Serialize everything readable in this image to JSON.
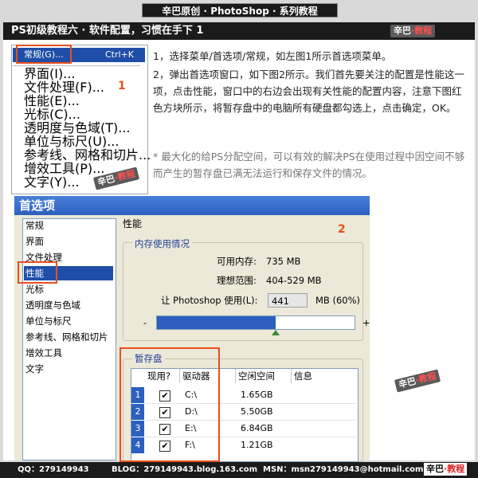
{
  "top_title": "辛巴原创 · PhotoShop · 系列教程",
  "heading": "PS初级教程六 · 软件配置，习惯在手下 1",
  "watermark": {
    "part1": "辛巴",
    "dot": "·",
    "part2": "教程"
  },
  "menu": {
    "selected_label": "常规(G)...",
    "selected_shortcut": "Ctrl+K",
    "items": [
      "界面(I)...",
      "文件处理(F)...",
      "性能(E)...",
      "光标(C)...",
      "透明度与色域(T)...",
      "单位与标尺(U)...",
      "参考线、网格和切片...",
      "增效工具(P)...",
      "文字(Y)..."
    ],
    "marker": "1"
  },
  "instructions": {
    "p1": "1，选择菜单/首选项/常规，如左图1所示首选项菜单。",
    "p2": "2，弹出首选项窗口，如下图2所示。我们首先要关注的配置是性能这一项，点击性能，窗口中的右边会出现有关性能的配置内容，注意下图红色方块所示，将暂存盘中的电脑所有硬盘都勾选上，点击确定，OK。",
    "note": "* 最大化的给PS分配空间，可以有效的解决PS在使用过程中因空间不够而产生的暂存盘已满无法运行和保存文件的情况。"
  },
  "prefs": {
    "title": "首选项",
    "marker": "2",
    "sidebar": [
      "常规",
      "界面",
      "文件处理",
      "性能",
      "光标",
      "透明度与色域",
      "单位与标尺",
      "参考线、网格和切片",
      "增效工具",
      "文字"
    ],
    "section_title": "性能",
    "memory": {
      "legend": "内存使用情况",
      "available_label": "可用内存:",
      "available_value": "735 MB",
      "ideal_label": "理想范围:",
      "ideal_value": "404-529 MB",
      "use_label": "让 Photoshop 使用(L):",
      "use_value": "441",
      "use_unit": "MB (60%)",
      "minus": "-",
      "plus": "+",
      "slider_fraction": 0.6
    },
    "scratch": {
      "legend": "暂存盘",
      "headers": [
        "现用?",
        "驱动器",
        "空闲空间",
        "信息"
      ],
      "rows": [
        {
          "num": "1",
          "check": "✔",
          "drive": "C:\\",
          "free": "1.65GB"
        },
        {
          "num": "2",
          "check": "✔",
          "drive": "D:\\",
          "free": "5.50GB"
        },
        {
          "num": "3",
          "check": "✔",
          "drive": "E:\\",
          "free": "6.84GB"
        },
        {
          "num": "4",
          "check": "✔",
          "drive": "F:\\",
          "free": "1.21GB"
        }
      ]
    }
  },
  "footer": {
    "qq": "QQ：279149943",
    "blog": "BLOG：279149943.blog.163.com",
    "msn": "MSN：msn279149943@hotmail.com",
    "brand1": "辛巴",
    "brand_dot": "·",
    "brand2": "教程"
  },
  "colors": {
    "accent_red": "#e8501e",
    "select_blue": "#1f4ea8",
    "title_blue": "#2c5fbf"
  }
}
